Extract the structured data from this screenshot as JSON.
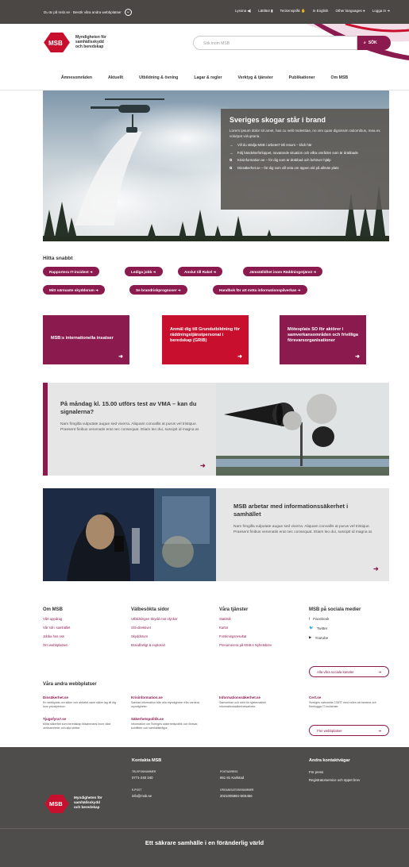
{
  "topbar": {
    "left_text": "Du är på msb.se · Besök våra andra webbplatser",
    "items": [
      "Lyssna",
      "Lättläst",
      "Teckenspråk",
      "In English",
      "Other languages",
      "Logga in"
    ]
  },
  "header": {
    "logo_mark": "MSB",
    "logo_line1": "Myndigheten för",
    "logo_line2": "samhällsskydd",
    "logo_line3": "och beredskap",
    "search_placeholder": "Sök inom MSB",
    "search_button": "SÖK"
  },
  "nav": [
    "Ämnesområden",
    "Aktuellt",
    "Utbildning & övning",
    "Lagar & regler",
    "Verktyg & tjänster",
    "Publikationer",
    "Om MSB"
  ],
  "hero": {
    "title": "Sveriges skogar står i brand",
    "text": "Lorem ipsum dolor sit amet, has cu velit molestiae, no vim quas dignissim ratiomibus, mea ex volutpat voluptaria.",
    "links": [
      {
        "text": "Vill du stödja MSB i arbetet? Bli resurs – klick här",
        "ext": false
      },
      {
        "text": "Följ händelseförloppet, nuvarande situation och vilka områden som är drabbade",
        "ext": false
      },
      {
        "text": "Krisinformation.se – för dig som är drabbad och behöver hjälp",
        "ext": true
      },
      {
        "text": "Dinsäkerhet.se – för dig som vill veta om öppen eld på allmän plats",
        "ext": true
      }
    ]
  },
  "quick": {
    "title": "Hitta snabbt",
    "pills": [
      "Rapportera IT-incident",
      "Lediga jobb",
      "Anslut till Rakel",
      "Jämställdhet inom Räddningstjänst",
      "Mitt närmaste skyddsrum",
      "Se brandriskprognoser",
      "Handbok för att möta informationspåverkan"
    ]
  },
  "cards": [
    {
      "text": "MSB:s internationella insatser",
      "color": "#8b1a4f"
    },
    {
      "text": "Anmäl dig till Grundutbildning för räddningstjänstpersonal i beredskap (GRIB)",
      "color": "#c8102e"
    },
    {
      "text": "Mötesplats SO för aktörer i samverkansområden och frivilliga försvarsorganisationer",
      "color": "#8b1a4f"
    }
  ],
  "feature1": {
    "title": "På måndag kl. 15.00 utförs test av VMA – kan du signalerna?",
    "text": "Nam fringilla vulputate augue sed viverra. Aliquam convallis at purus vel tristique. Praesent finibus venenatis erat nec consequat. Etiam leo dui, suscipit id magna at."
  },
  "feature2": {
    "title": "MSB arbetar med informationssäkerhet i samhället",
    "text": "Nam fringilla vulputate augue sed viverra. Aliquam convallis at purus vel tristique. Praesent finibus venenatis erat nec consequat. Etiam leo dui, suscipit id magna at."
  },
  "footer": {
    "cols": [
      {
        "title": "Om MSB",
        "links": [
          "Vårt uppdrag",
          "Vår roll i samhället",
          "Jobba hos oss",
          "Om webbplatsen"
        ]
      },
      {
        "title": "Välbesökta sidor",
        "links": [
          "Utbildningen Skydd mot olyckor",
          "SIS-direktivet",
          "Skyddsrum",
          "Brandfarligt & explosivt"
        ]
      },
      {
        "title": "Våra tjänster",
        "links": [
          "Statistik",
          "Kartor",
          "Forskningsresultat",
          "Prenumerera på MSB:s Nyhetsbrev"
        ]
      }
    ],
    "social": {
      "title": "MSB på sociala medier",
      "items": [
        "Facebook",
        "Twitter",
        "Youtube"
      ],
      "button": "Alla våra sociala kanaler"
    },
    "other_title": "Våra andra webbplatser",
    "other_sites": [
      {
        "name": "Dinsäkerhet.se",
        "desc": "En webbplats om säker och aktivitet samt säker lag till dig som privatperson."
      },
      {
        "name": "Krisinformation.se",
        "desc": "Samlad information från alla myndigheter från vardera myndigheter."
      },
      {
        "name": "Informationssäkerhet.se",
        "desc": "Samverkan och stöd för systematiskt informationssäkerhetsarbete."
      },
      {
        "name": "Cert.se",
        "desc": "Sveriges nationella CSIRT med rollen att hantera och förebygga IT-incidenter."
      },
      {
        "name": "Tjugofyra7.se",
        "desc": "Möta säkerhet som beredskap tillsammans inom våra verksamheter och alla stöttar."
      },
      {
        "name": "Säkerhetspolitik.se",
        "desc": "Information om Sveriges säkerhetspolitik och försvar, konflikter och samhällsfrågor."
      }
    ],
    "other_button": "Fler webbplatser"
  },
  "dark_footer": {
    "logo_mark": "MSB",
    "logo_text": [
      "Myndigheten för",
      "samhällsskydd",
      "och beredskap"
    ],
    "contact_title": "Kontakta MSB",
    "phone_label": "TELEFONNUMMER",
    "phone": "0771-240 240",
    "email_label": "E-POST",
    "email": "info@msb.se",
    "post_label": "POSTADRESS",
    "post": "651 81 Karlstad",
    "org_label": "ORGANISATIONSNUMMER",
    "org": "2021005984-SE5456",
    "other_title": "Andra kontaktvägar",
    "other_links": [
      "För press",
      "Registratorservice och öppet brev"
    ],
    "slogan": "Ett säkrare samhälle i en föränderlig värld"
  },
  "colors": {
    "brand": "#8b1a4f",
    "red": "#c8102e",
    "dark": "#4a4745"
  }
}
